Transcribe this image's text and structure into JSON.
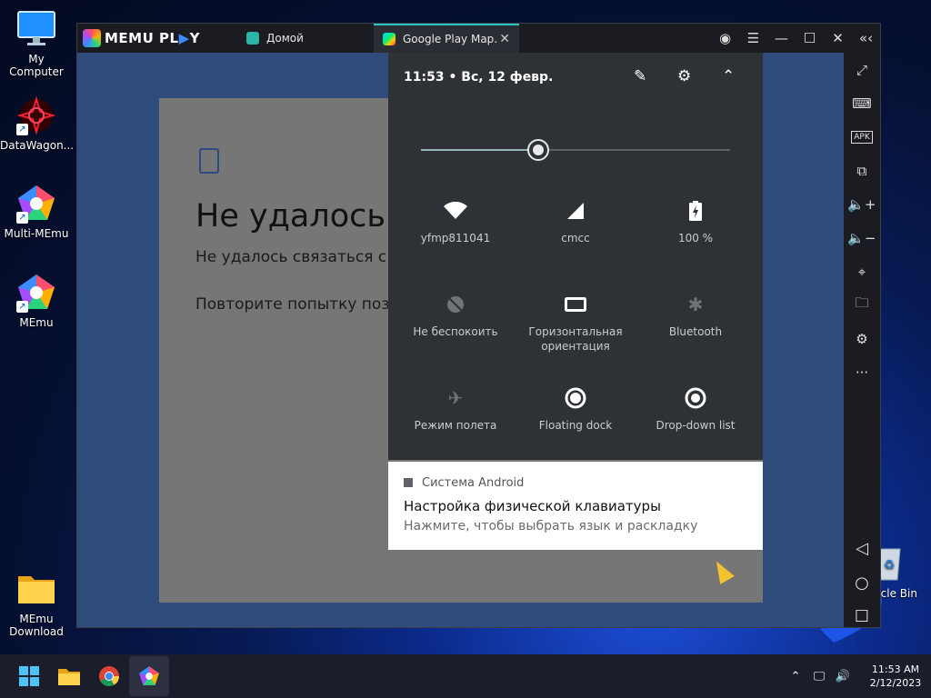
{
  "desktop": {
    "icons": [
      {
        "label": "My Computer"
      },
      {
        "label": "DataWagon..."
      },
      {
        "label": "Multi-MEmu"
      },
      {
        "label": "MEmu"
      },
      {
        "label": "MEmu\nDownload"
      },
      {
        "label": "rcle Bin"
      }
    ]
  },
  "emulator": {
    "brand": "MEMU PL",
    "brand_suffix": "Y",
    "tabs": [
      {
        "label": "Домой"
      },
      {
        "label": "Google Play Map."
      }
    ],
    "tab_close": "✕",
    "window_controls": [
      "account-icon",
      "menu-icon",
      "minimize-icon",
      "maximize-icon",
      "close-icon",
      "collapse-sidebar-icon"
    ],
    "sidebar": [
      "fullscreen-icon",
      "keyboard-icon",
      "apk-icon",
      "multi-window-icon",
      "volume-up-icon",
      "volume-down-icon",
      "location-icon",
      "folder-icon",
      "settings-icon",
      "more-icon"
    ],
    "apk_label": "APK"
  },
  "app": {
    "title": "Не удалось",
    "line1": "Не удалось связаться с с",
    "line2": "Повторите попытку позж"
  },
  "quick_settings": {
    "time": "11:53",
    "date": "Вс, 12 февр.",
    "brightness": 0.38,
    "tiles": [
      {
        "label": "yfmp811041",
        "icon": "wifi-icon",
        "on": true
      },
      {
        "label": "cmcc",
        "icon": "signal-icon",
        "on": true
      },
      {
        "label": "100 %",
        "icon": "battery-icon",
        "on": true
      },
      {
        "label": "Не беспокоить",
        "icon": "dnd-icon",
        "on": false
      },
      {
        "label": "Горизонтальная ориентация",
        "icon": "rotation-icon",
        "on": true
      },
      {
        "label": "Bluetooth",
        "icon": "bluetooth-icon",
        "on": false
      },
      {
        "label": "Режим полета",
        "icon": "airplane-icon",
        "on": false
      },
      {
        "label": "Floating dock",
        "icon": "floating-dock-icon",
        "on": true
      },
      {
        "label": "Drop-down list",
        "icon": "dropdown-list-icon",
        "on": true
      }
    ]
  },
  "notification": {
    "source": "Система Android",
    "title": "Настройка физической клавиатуры",
    "subtitle": "Нажмите, чтобы выбрать язык и раскладку"
  },
  "taskbar": {
    "apps": [
      "start-icon",
      "file-explorer-icon",
      "chrome-icon",
      "memu-icon"
    ],
    "time": "11:53 AM",
    "date": "2/12/2023"
  }
}
